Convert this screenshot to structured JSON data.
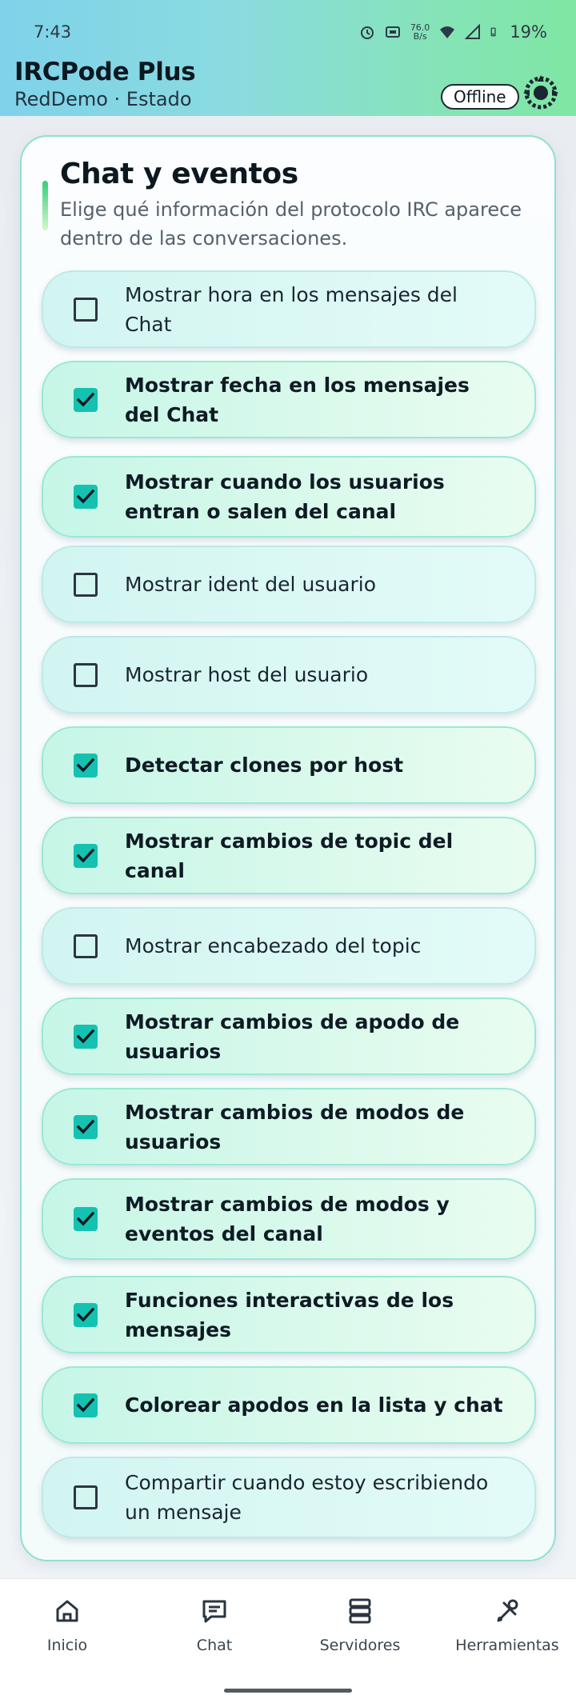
{
  "status_bar": {
    "time": "7:43",
    "net_speed_value": "76.0",
    "net_speed_unit": "B/s",
    "battery": "19%",
    "icons": [
      "alarm-icon",
      "nfc-icon",
      "wifi-icon",
      "signal-icon",
      "battery-icon"
    ]
  },
  "header": {
    "title": "IRCPode Plus",
    "subtitle": "RedDemo · Estado",
    "status_badge": "Offline",
    "logo_icon": "dragon-logo-icon"
  },
  "section": {
    "title": "Chat y eventos",
    "description": "Elige qué información del protocolo IRC aparece dentro de las conversaciones."
  },
  "options": [
    {
      "label": "Mostrar hora en los mensajes del Chat",
      "checked": false
    },
    {
      "label": "Mostrar fecha en los mensajes del Chat",
      "checked": true
    },
    {
      "label": "Mostrar cuando los usuarios entran o salen del canal",
      "checked": true
    },
    {
      "label": "Mostrar ident del usuario",
      "checked": false
    },
    {
      "label": "Mostrar host del usuario",
      "checked": false
    },
    {
      "label": "Detectar clones por host",
      "checked": true
    },
    {
      "label": "Mostrar cambios de topic del canal",
      "checked": true
    },
    {
      "label": "Mostrar encabezado del topic",
      "checked": false
    },
    {
      "label": "Mostrar cambios de apodo de usuarios",
      "checked": true
    },
    {
      "label": "Mostrar cambios de modos de usuarios",
      "checked": true
    },
    {
      "label": "Mostrar cambios de modos y eventos del canal",
      "checked": true
    },
    {
      "label": "Funciones interactivas de los mensajes",
      "checked": true
    },
    {
      "label": "Colorear apodos en la lista y chat",
      "checked": true
    },
    {
      "label": "Compartir cuando estoy escribiendo un mensaje",
      "checked": false
    }
  ],
  "bottom_nav": [
    {
      "label": "Inicio",
      "icon": "home-icon"
    },
    {
      "label": "Chat",
      "icon": "chat-icon"
    },
    {
      "label": "Servidores",
      "icon": "server-icon"
    },
    {
      "label": "Herramientas",
      "icon": "tools-icon"
    }
  ],
  "colors": {
    "accent": "#15c2b1",
    "header_start": "#7fd2ea",
    "header_end": "#7fe6a3"
  }
}
